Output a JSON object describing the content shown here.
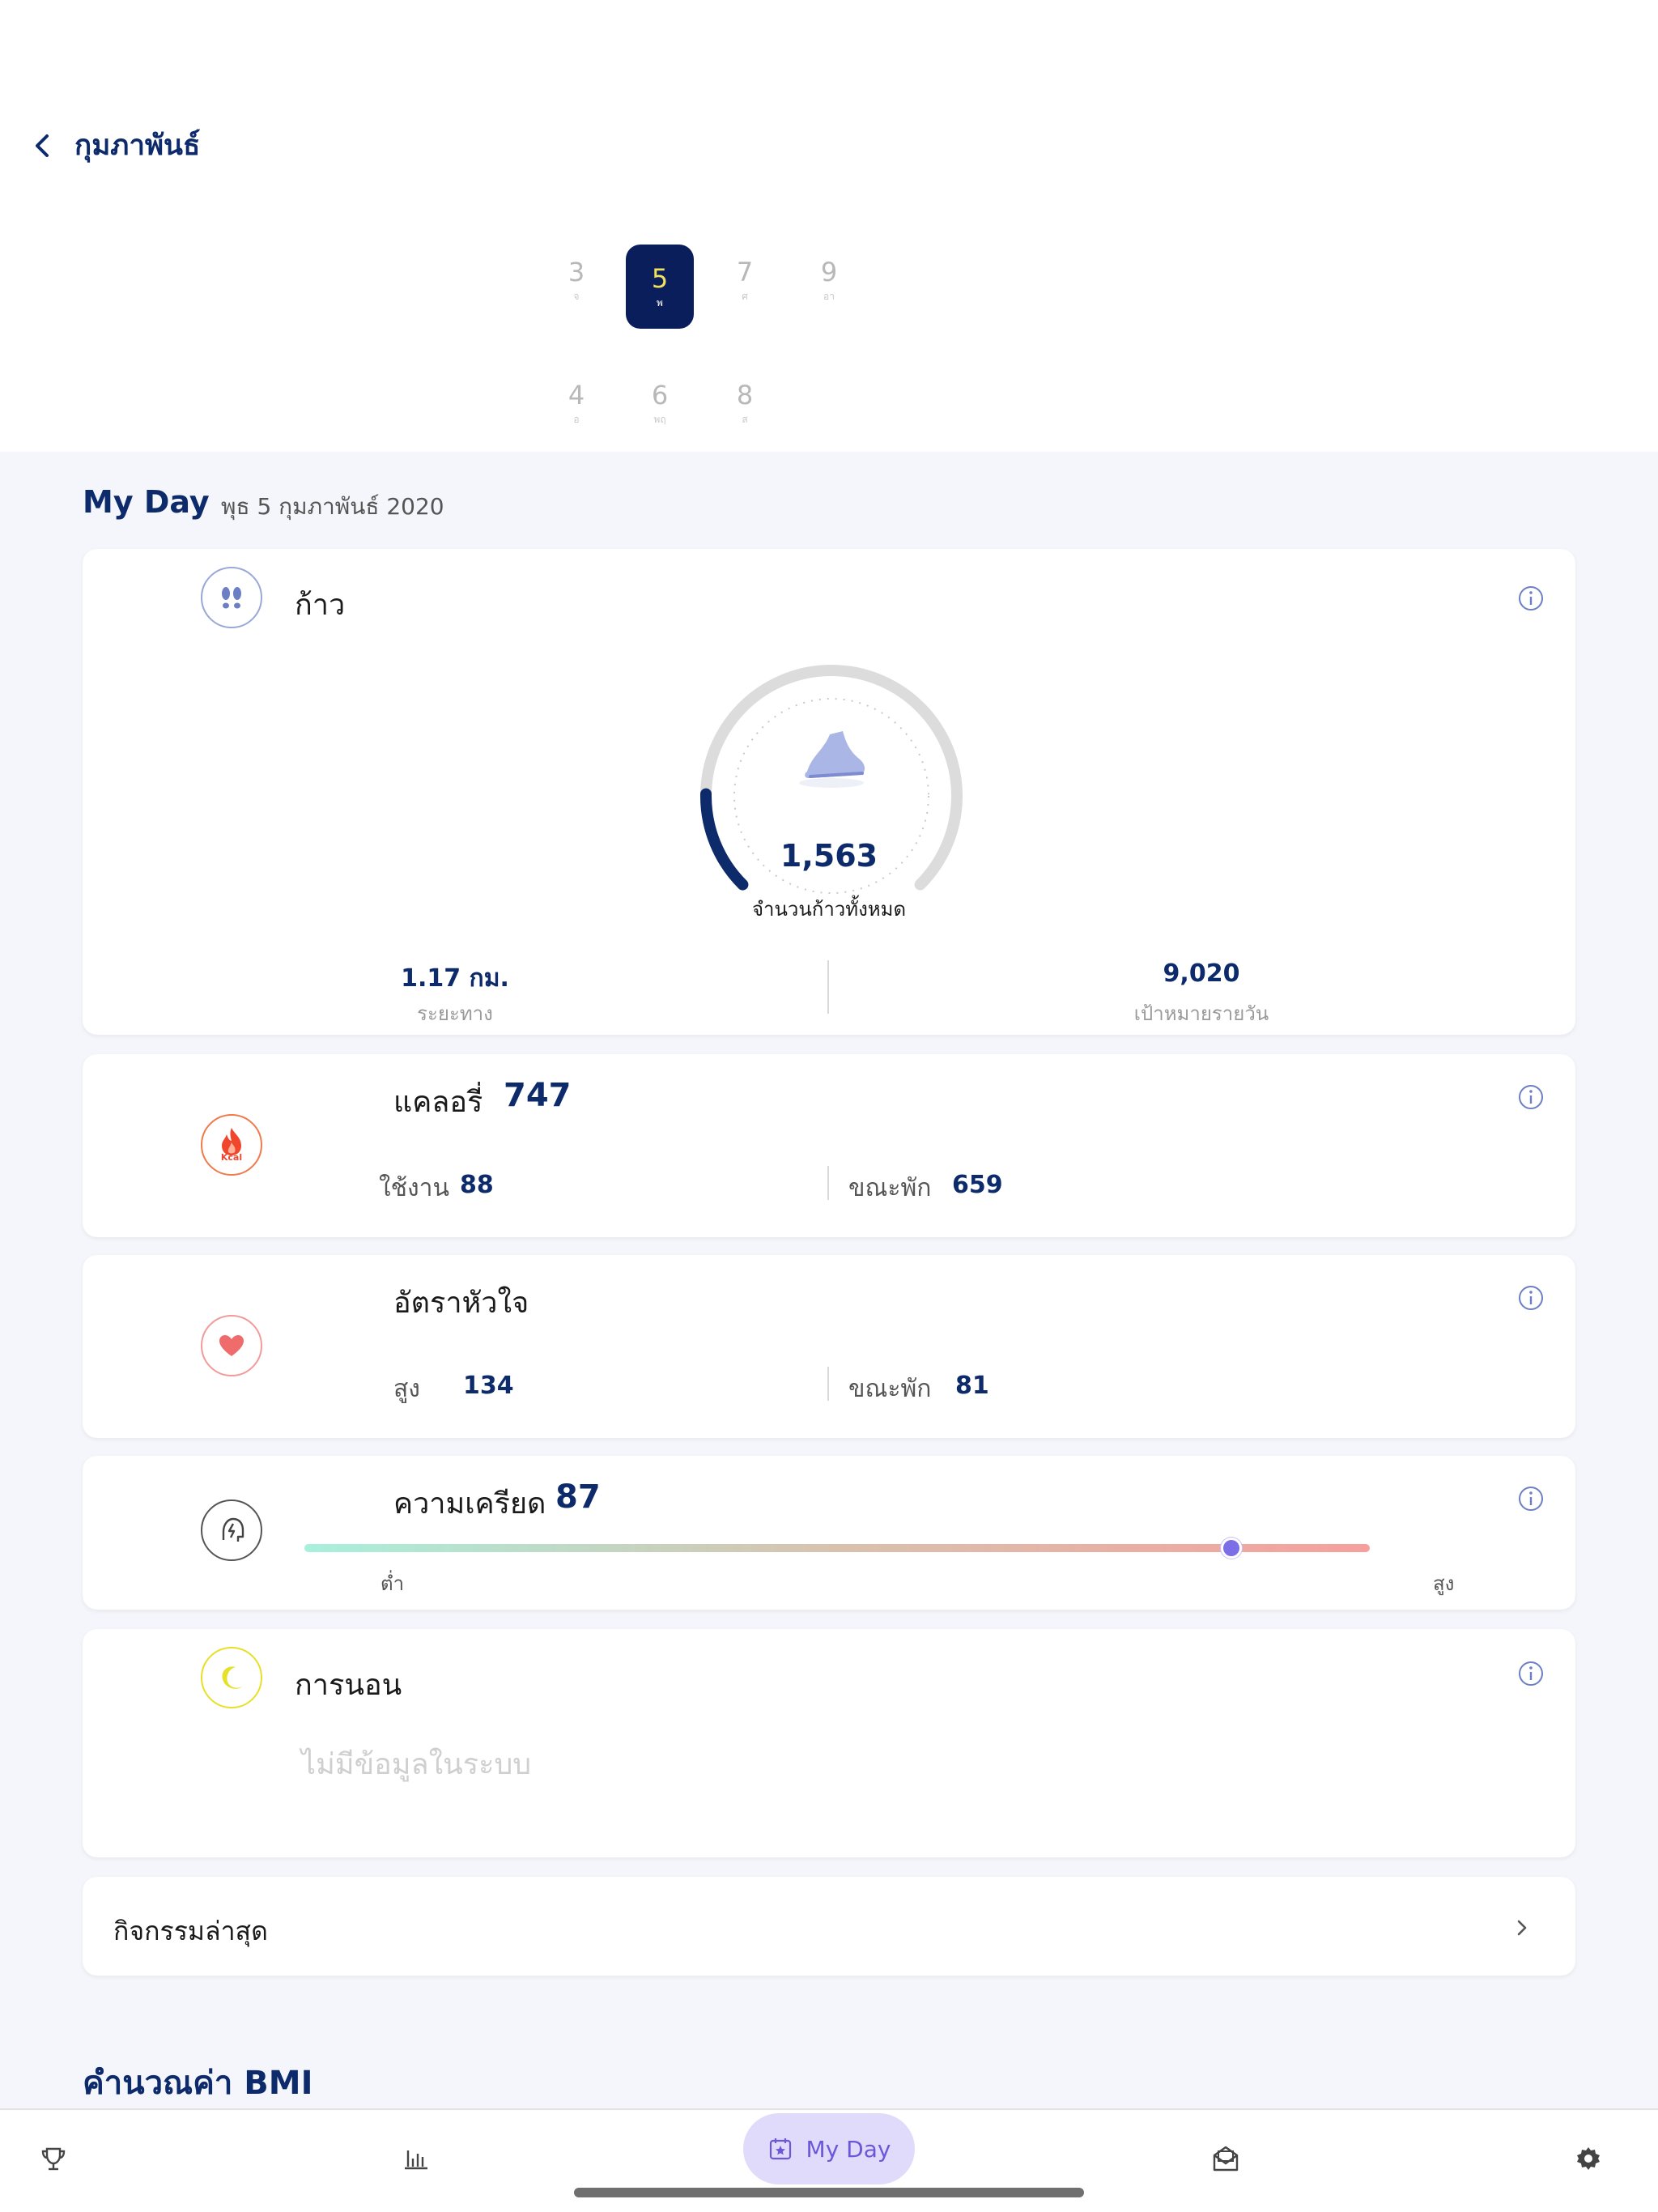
{
  "header": {
    "month": "กุมภาพันธ์"
  },
  "calendar": {
    "dates": [
      {
        "num": "3",
        "day": "จ"
      },
      {
        "num": "5",
        "day": "พ",
        "active": true
      },
      {
        "num": "7",
        "day": "ศ"
      },
      {
        "num": "9",
        "day": "อา"
      },
      {
        "num": "4",
        "day": "อ"
      },
      {
        "num": "6",
        "day": "พฤ"
      },
      {
        "num": "8",
        "day": "ส"
      }
    ]
  },
  "myday": {
    "title": "My Day",
    "date": "พุธ 5 กุมภาพันธ์ 2020"
  },
  "steps": {
    "title": "ก้าว",
    "value": "1,563",
    "label": "จำนวนก้าวทั้งหมด",
    "progress": 0.17,
    "distance_value": "1.17 กม.",
    "distance_label": "ระยะทาง",
    "goal_value": "9,020",
    "goal_label": "เป้าหมายรายวัน"
  },
  "calories": {
    "title": "แคลอรี่",
    "value": "747",
    "icon_text": "Kcal",
    "active_label": "ใช้งาน",
    "active_value": "88",
    "rest_label": "ขณะพัก",
    "rest_value": "659"
  },
  "heart": {
    "title": "อัตราหัวใจ",
    "high_label": "สูง",
    "high_value": "134",
    "rest_label": "ขณะพัก",
    "rest_value": "81"
  },
  "stress": {
    "title": "ความเครียด",
    "value": "87",
    "level": 0.87,
    "low_label": "ต่ำ",
    "high_label": "สูง"
  },
  "sleep": {
    "title": "การนอน",
    "no_data": "ไม่มีข้อมูลในระบบ"
  },
  "activity": {
    "title": "กิจกรรมล่าสุด"
  },
  "bmi": {
    "title": "คำนวณค่า BMI"
  },
  "nav": {
    "active_label": "My Day"
  },
  "colors": {
    "primary": "#0d2a6b",
    "accent_yellow": "#f2e25a",
    "stress_knob": "#7b6ee6",
    "calorie_red": "#f0462e",
    "heart_red": "#f06b6b",
    "sleep_yellow": "#e6e02a"
  }
}
